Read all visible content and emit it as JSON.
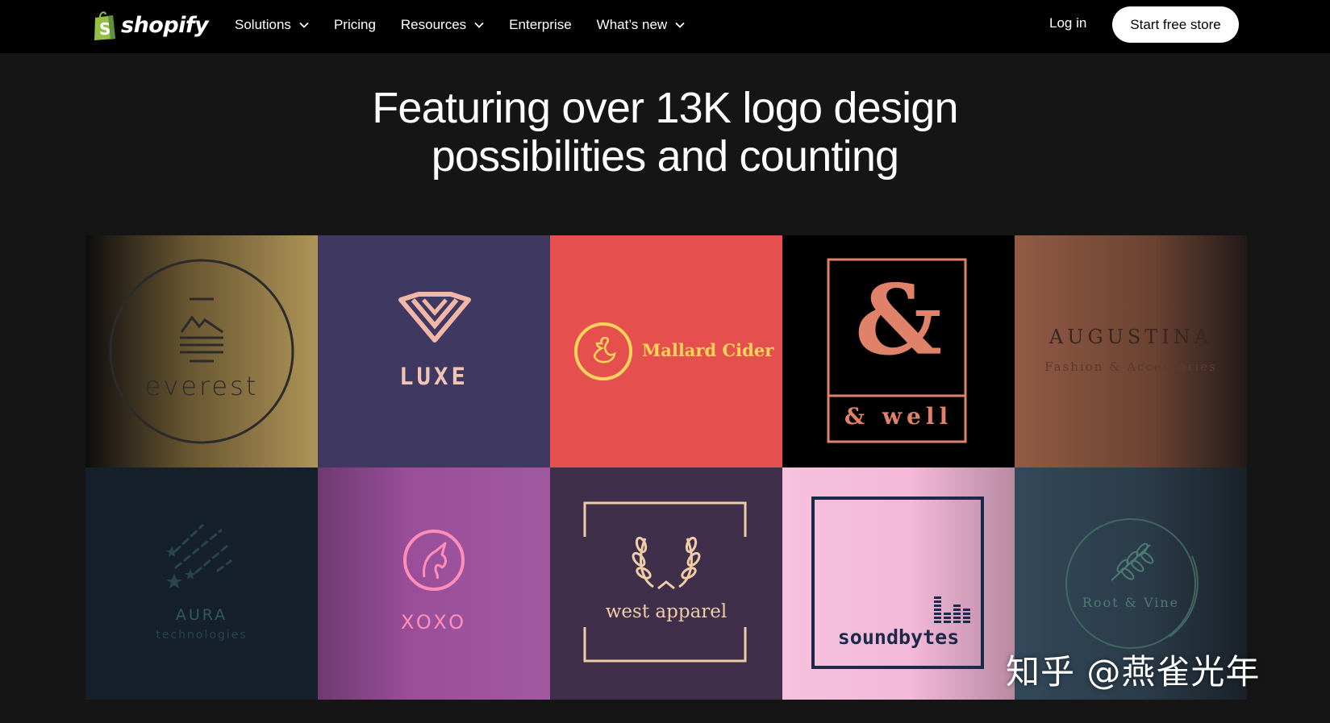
{
  "nav": {
    "brand": "shopify",
    "links": [
      {
        "label": "Solutions",
        "dropdown": true
      },
      {
        "label": "Pricing",
        "dropdown": false
      },
      {
        "label": "Resources",
        "dropdown": true
      },
      {
        "label": "Enterprise",
        "dropdown": false
      },
      {
        "label": "What’s new",
        "dropdown": true
      }
    ],
    "login": "Log in",
    "cta": "Start free store"
  },
  "hero": {
    "line1": "Featuring over 13K logo design",
    "line2": "possibilities and counting"
  },
  "logos": {
    "everest": {
      "name": "everest",
      "icon": "mountain-sun-icon"
    },
    "luxe": {
      "name": "LUXE",
      "icon": "diamond-icon"
    },
    "mallard": {
      "name": "Mallard Cider",
      "icon": "duck-icon"
    },
    "well": {
      "symbol": "&",
      "name": "& well"
    },
    "augustina": {
      "name": "AUGUSTINA",
      "tagline": "Fashion & Accessories"
    },
    "aura": {
      "name": "AURA",
      "tagline": "technologies",
      "icon": "shooting-stars-icon"
    },
    "xoxo": {
      "name": "XOXO",
      "icon": "unicorn-icon"
    },
    "west": {
      "name": "west apparel",
      "icon": "laurel-wreath-icon"
    },
    "sound": {
      "name": "soundbytes",
      "icon": "equalizer-icon"
    },
    "root": {
      "name": "Root & Vine",
      "icon": "wheat-icon"
    }
  },
  "watermark": "知乎 @燕雀光年",
  "colors": {
    "nav_bg": "#000000",
    "page_bg": "#151515",
    "cta_bg": "#ffffff",
    "everest": "#ae9457",
    "luxe": "#3f3860",
    "mallard": "#e5504e",
    "well_accent": "#e0826a",
    "augustina": "#935b45",
    "aura": "#16202b",
    "xoxo": "#9a4e9a",
    "west": "#3f2f4a",
    "sound": "#f6c2de",
    "root": "#33485a"
  }
}
